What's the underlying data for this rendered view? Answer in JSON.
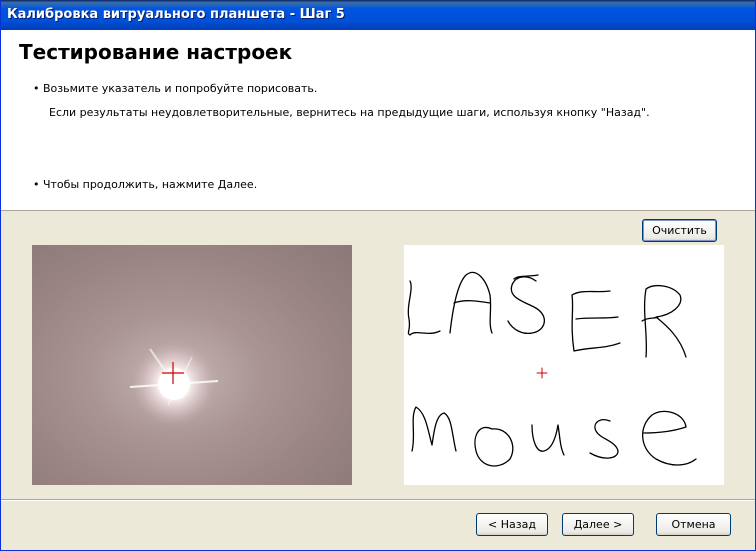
{
  "window": {
    "title": "Калибровка витруального планшета - Шаг 5"
  },
  "header": {
    "title": "Тестирование настроек",
    "bullet1": "• Возьмите указатель и  попробуйте порисовать.",
    "note": "Если результаты неудовлетворительные, вернитесь на предыдущие шаги, используя кнопку \"Назад\".",
    "bullet2": "• Чтобы продолжить, нажмите Далее."
  },
  "toolbar": {
    "clear_label": "Очистить"
  },
  "drawing": {
    "row1_text": "LASER",
    "row2_text": "mouse"
  },
  "footer": {
    "back_label": "< Назад",
    "next_label": "Далее >",
    "cancel_label": "Отмена"
  },
  "colors": {
    "title_bar": "#0054e3",
    "crosshair": "#cc0000",
    "stroke": "#000000"
  }
}
